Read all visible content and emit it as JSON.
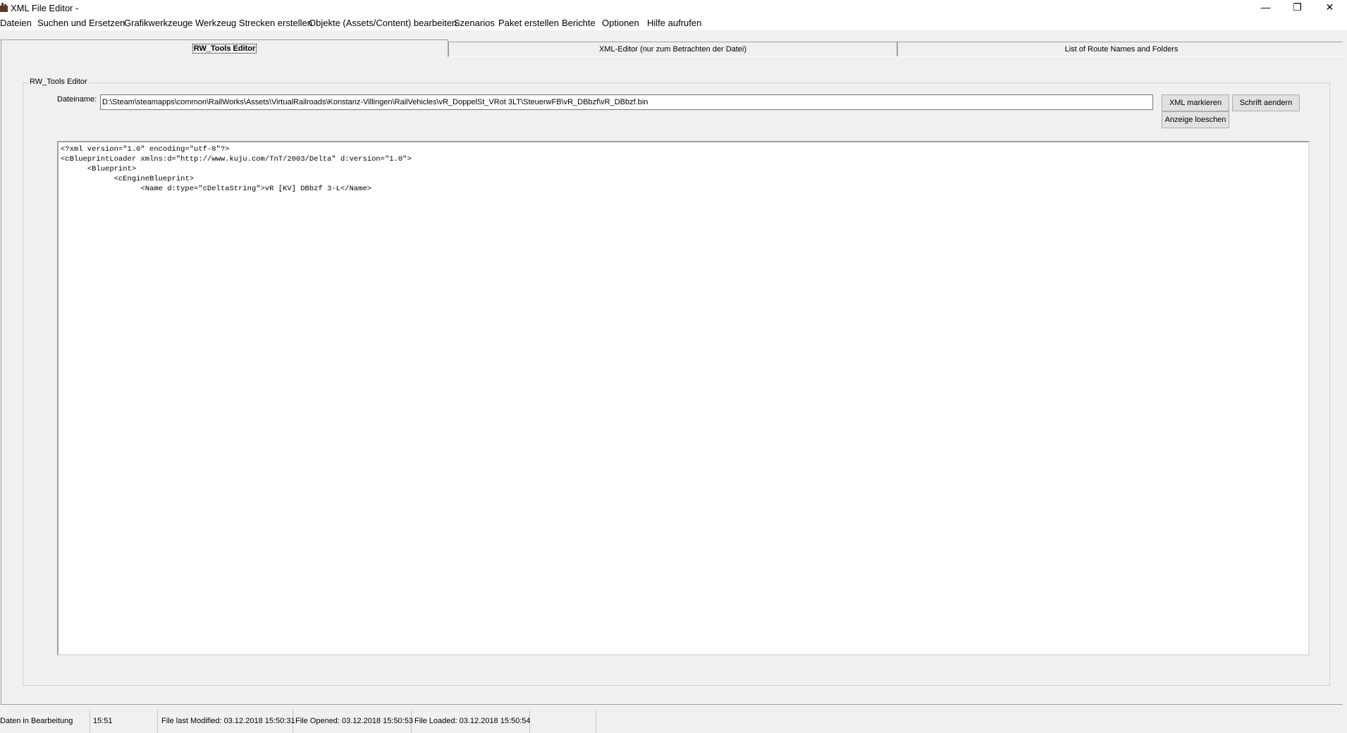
{
  "window": {
    "title": "XML File Editor -",
    "minimize_glyph": "—",
    "restore_glyph": "❐",
    "close_glyph": "✕"
  },
  "menu": [
    "Dateien",
    "Suchen und Ersetzen",
    "Grafikwerkzeuge",
    "Werkzeug Strecken erstellen",
    "Objekte (Assets/Content) bearbeiten",
    "Szenarios",
    "Paket erstellen",
    "Berichte",
    "Optionen",
    "Hilfe aufrufen"
  ],
  "tabs": [
    {
      "label": "RW_Tools Editor",
      "active": true
    },
    {
      "label": "XML-Editor (nur zum Betrachten der Datei)",
      "active": false
    },
    {
      "label": "List of Route Names and Folders",
      "active": false
    }
  ],
  "editor": {
    "group_title": "RW_Tools Editor",
    "file_label": "Dateiname:",
    "file_path": "D:\\Steam\\steamapps\\common\\RailWorks\\Assets\\VirtualRailroads\\Konstanz-Villingen\\RailVehicles\\vR_DoppelSt_VRot 3LT\\SteuerwFB\\vR_DBbzf\\vR_DBbzf.bin",
    "buttons": {
      "mark_xml": "XML markieren",
      "change_font": "Schrift aendern",
      "clear_display": "Anzeige loeschen"
    },
    "content": "<?xml version=\"1.0\" encoding=\"utf-8\"?>\n<cBlueprintLoader xmlns:d=\"http://www.kuju.com/TnT/2003/Delta\" d:version=\"1.0\">\n\t<Blueprint>\n\t\t<cEngineBlueprint>\n\t\t\t<Name d:type=\"cDeltaString\">vR [KV] DBbzf 3-L</Name>"
  },
  "status": {
    "state": "Daten in Bearbeitung",
    "time": "15:51",
    "last_modified": "File last Modified: 03.12.2018 15:50:31",
    "opened": "File Opened: 03.12.2018 15:50:53",
    "loaded": "File Loaded: 03.12.2018 15:50:54",
    "extra": ""
  },
  "colors": {
    "window_bg": "#f0f0f0",
    "title_bg": "#ffffff",
    "app_icon": "#5a3a28"
  },
  "icons": {
    "app": "app-icon",
    "minimize": "minimize-icon",
    "restore": "restore-icon",
    "close": "close-icon"
  }
}
